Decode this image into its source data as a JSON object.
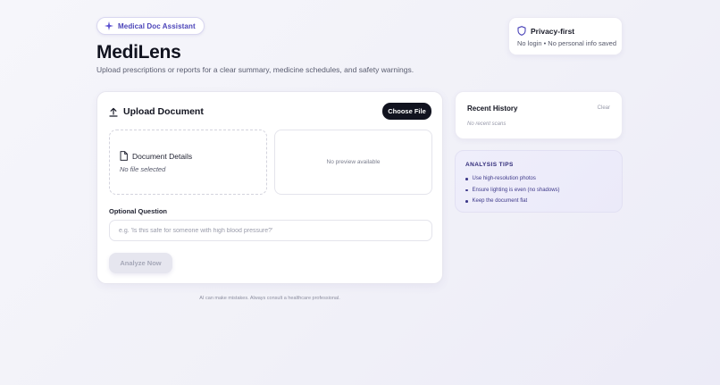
{
  "header": {
    "badge_label": "Medical Doc Assistant",
    "app_title": "MediLens",
    "subtitle": "Upload prescriptions or reports for a clear summary, medicine schedules, and safety warnings."
  },
  "privacy": {
    "title": "Privacy-first",
    "subtitle": "No login • No personal info saved"
  },
  "upload": {
    "title": "Upload Document",
    "choose_file_label": "Choose File",
    "details_title": "Document Details",
    "details_status": "No file selected",
    "preview_text": "No preview available",
    "question_label": "Optional Question",
    "question_value": "",
    "question_placeholder": "e.g. 'Is this safe for someone with high blood pressure?'",
    "analyze_label": "Analyze Now"
  },
  "disclaimer": "AI can make mistakes. Always consult a healthcare professional.",
  "history": {
    "title": "Recent History",
    "clear_label": "Clear",
    "empty_text": "No recent scans"
  },
  "tips": {
    "title": "ANALYSIS TIPS",
    "items": [
      "Use high-resolution photos",
      "Ensure lighting is even (no shadows)",
      "Keep the document flat"
    ]
  },
  "colors": {
    "accent": "#4a43b8",
    "primary_button": "#11131f",
    "disabled_button": "#e6e6ef"
  }
}
